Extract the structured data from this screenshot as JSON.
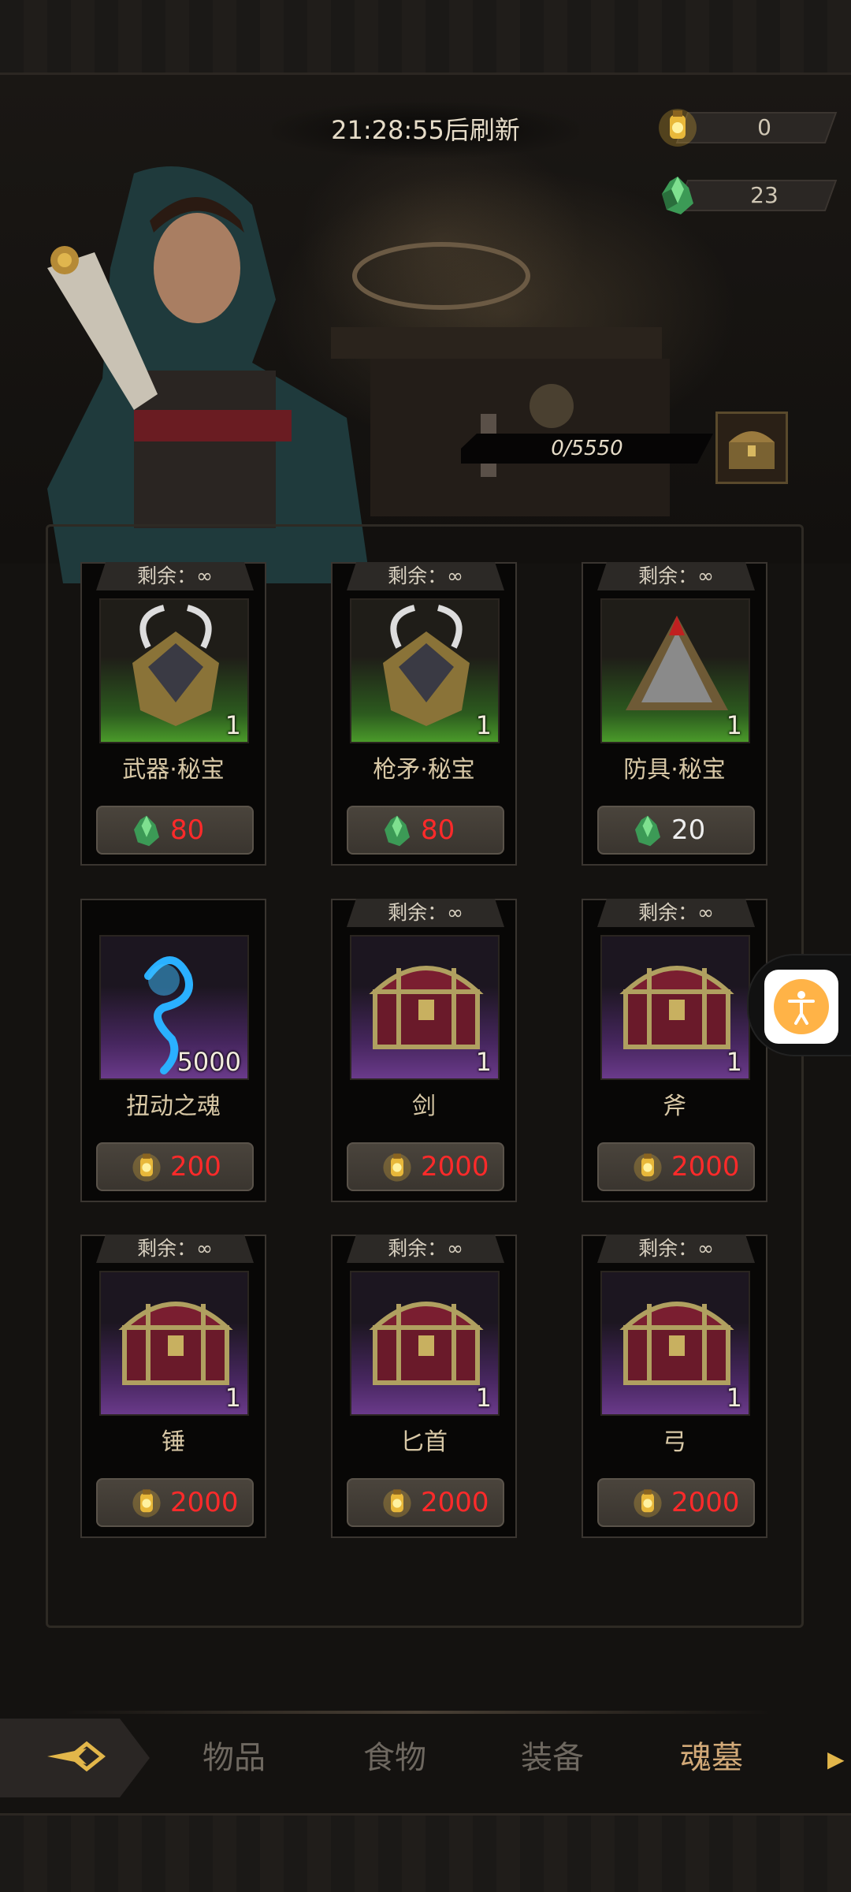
{
  "header": {
    "refresh_text": "21:28:55后刷新"
  },
  "currencies": [
    {
      "icon": "lantern-coin-icon",
      "value": "0"
    },
    {
      "icon": "green-crystal-icon",
      "value": "23"
    }
  ],
  "progress": {
    "text": "0/5550"
  },
  "shop_items": [
    {
      "stock": "剩余：∞",
      "name": "武器·秘宝",
      "count": "1",
      "price": "80",
      "currency": "green-crystal-icon",
      "affordable": false,
      "bg": "green",
      "art": "treasure-armor"
    },
    {
      "stock": "剩余：∞",
      "name": "枪矛·秘宝",
      "count": "1",
      "price": "80",
      "currency": "green-crystal-icon",
      "affordable": false,
      "bg": "green",
      "art": "treasure-armor"
    },
    {
      "stock": "剩余：∞",
      "name": "防具·秘宝",
      "count": "1",
      "price": "20",
      "currency": "green-crystal-icon",
      "affordable": true,
      "bg": "green",
      "art": "treasure-pyramid"
    },
    {
      "stock": "",
      "name": "扭动之魂",
      "count": "5000",
      "price": "200",
      "currency": "lantern-coin-icon",
      "affordable": false,
      "bg": "purple",
      "art": "soul-wisp"
    },
    {
      "stock": "剩余：∞",
      "name": "剑",
      "count": "1",
      "price": "2000",
      "currency": "lantern-coin-icon",
      "affordable": false,
      "bg": "purple",
      "art": "chest"
    },
    {
      "stock": "剩余：∞",
      "name": "斧",
      "count": "1",
      "price": "2000",
      "currency": "lantern-coin-icon",
      "affordable": false,
      "bg": "purple",
      "art": "chest"
    },
    {
      "stock": "剩余：∞",
      "name": "锤",
      "count": "1",
      "price": "2000",
      "currency": "lantern-coin-icon",
      "affordable": false,
      "bg": "purple",
      "art": "chest"
    },
    {
      "stock": "剩余：∞",
      "name": "匕首",
      "count": "1",
      "price": "2000",
      "currency": "lantern-coin-icon",
      "affordable": false,
      "bg": "purple",
      "art": "chest"
    },
    {
      "stock": "剩余：∞",
      "name": "弓",
      "count": "1",
      "price": "2000",
      "currency": "lantern-coin-icon",
      "affordable": false,
      "bg": "purple",
      "art": "chest"
    }
  ],
  "tabs": [
    {
      "label": "物品",
      "active": false
    },
    {
      "label": "食物",
      "active": false
    },
    {
      "label": "装备",
      "active": false
    },
    {
      "label": "魂墓",
      "active": true
    }
  ],
  "colors": {
    "price_unaffordable": "#ff2a2a",
    "price_ok": "#eeeeee",
    "tab_active": "#d2a978"
  }
}
